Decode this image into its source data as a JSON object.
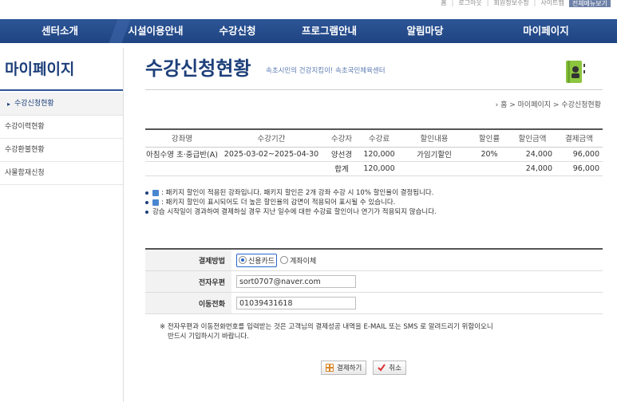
{
  "top_links": [
    "홈",
    "로그아웃",
    "회원정보수정",
    "사이트맵",
    "전체메뉴보기"
  ],
  "nav": [
    "센터소개",
    "시설이용안내",
    "수강신청",
    "프로그램안내",
    "알림마당",
    "마이페이지"
  ],
  "sidebar": {
    "title": "마이페이지",
    "items": [
      {
        "label": "수강신청현황"
      },
      {
        "label": "수강이력현황"
      },
      {
        "label": "수강환불현황"
      },
      {
        "label": "사물함재신청"
      }
    ]
  },
  "page": {
    "title": "수강신청현황",
    "subtitle": "속초시민의 건강지킴이! 속초국민체육센터",
    "breadcrumb": "› 홈 > 마이페이지 > 수강신청현황"
  },
  "table": {
    "headers": [
      "강좌명",
      "수강기간",
      "수강자",
      "수강료",
      "할인내용",
      "할인률",
      "할인금액",
      "결제금액"
    ],
    "row": [
      "아침수영 초·중급반(A)",
      "2025-03-02~2025-04-30",
      "양선경",
      "120,000",
      "가임기할인",
      "20%",
      "24,000",
      "96,000"
    ],
    "total": {
      "label": "합계",
      "fee": "120,000",
      "discount": "24,000",
      "payment": "96,000"
    }
  },
  "notes": [
    ": 패키지 할인이 적용된 강좌입니다. 패키지 할인은 2개 강좌 수강 시 10% 할인율이 결정됩니다.",
    ": 패키지 할인이 표시되어도 더 높은 할인율의 감면이 적용되어 표시될 수 있습니다.",
    "강습 시작일이 경과하여 결제하실 경우 지난 일수에 대한 수강료 할인이나 연기가 적용되지 않습니다."
  ],
  "payment": {
    "method_label": "결제방법",
    "option_card": "신용카드",
    "option_transfer": "계좌이체",
    "email_label": "전자우편",
    "email_value": "sort0707@naver.com",
    "phone_label": "이동전화",
    "phone_value": "01039431618",
    "note_line1": "※ 전자우편과 이동전화번호를 입력받는 것은 고객님의 결제성공 내역을 E-MAIL 또는 SMS 로 알려드리기 위함이오니",
    "note_line2": "반드시 기입하시기 바랍니다."
  },
  "buttons": {
    "pay": "결제하기",
    "cancel": "취소"
  }
}
